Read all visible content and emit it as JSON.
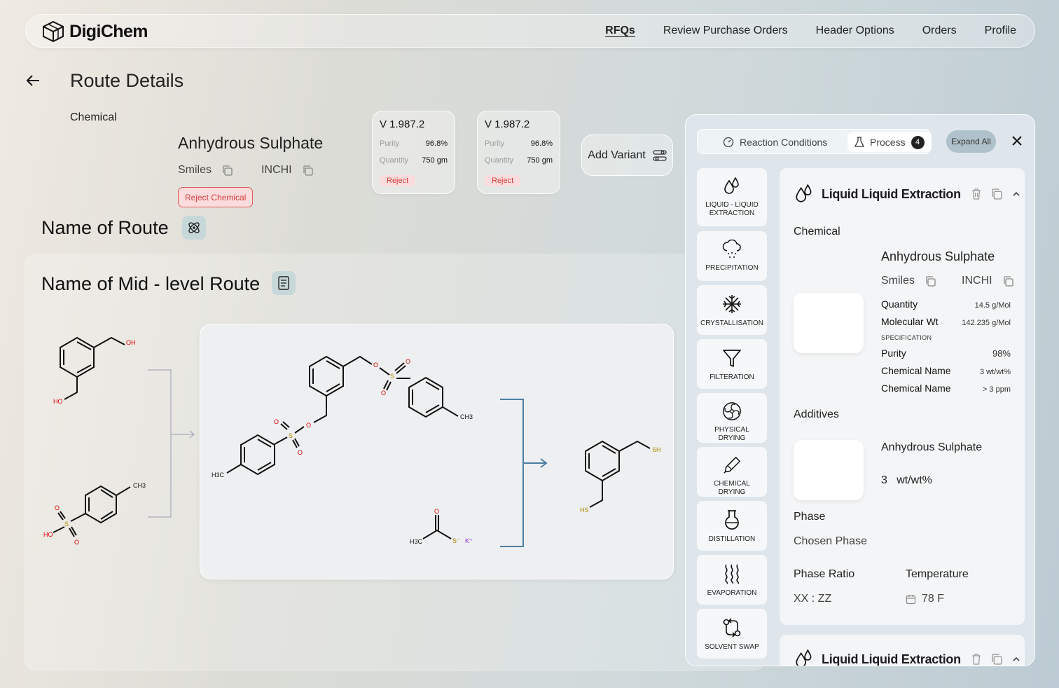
{
  "nav": {
    "brand": "DigiChem",
    "links": [
      "RFQs",
      "Review Purchase Orders",
      "Header Options",
      "Orders",
      "Profile"
    ]
  },
  "page": {
    "title": "Route Details",
    "chemical_label": "Chemical",
    "chemical_name": "Anhydrous Sulphate",
    "smiles_label": "Smiles",
    "inchi_label": "INCHI",
    "reject_chemical": "Reject Chemical"
  },
  "variants": [
    {
      "title": "V 1.987.2",
      "purity_label": "Purity",
      "purity": "96.8%",
      "quantity_label": "Quantity",
      "quantity": "750 gm",
      "reject": "Reject"
    },
    {
      "title": "V 1.987.2",
      "purity_label": "Purity",
      "purity": "96.8%",
      "quantity_label": "Quantity",
      "quantity": "750 gm",
      "reject": "Reject"
    }
  ],
  "add_variant": "Add Variant",
  "route": {
    "name": "Name of Route",
    "mid_level_name": "Name of Mid - level Route"
  },
  "structures": {
    "reactant1": {
      "oh": "OH",
      "ho": "HO"
    },
    "reactant2": {
      "ch3": "CH3",
      "s": "S",
      "o": "O",
      "ho": "HO"
    },
    "main": {
      "ch3": "CH3",
      "h3c": "H3C",
      "o": "O",
      "s": "S"
    },
    "reagent": {
      "h3c": "H3C",
      "o": "O",
      "s": "S⁻",
      "k": "K⁺"
    },
    "product": {
      "sh": "SH",
      "hs": "HS"
    }
  },
  "panel": {
    "tabs": {
      "reaction_conditions": "Reaction Conditions",
      "process": "Process",
      "process_count": "4"
    },
    "expand_all": "Expand All",
    "processes": [
      {
        "label": "LIQUID - LIQUID EXTRACTION",
        "icon": "drops-icon"
      },
      {
        "label": "PRECIPITATION",
        "icon": "cloud-rain-icon"
      },
      {
        "label": "CRYSTALLISATION",
        "icon": "snowflake-icon"
      },
      {
        "label": "FILTERATION",
        "icon": "funnel-icon"
      },
      {
        "label": "PHYSICAL DRYING",
        "icon": "fan-icon"
      },
      {
        "label": "CHEMICAL DRYING",
        "icon": "pipette-icon"
      },
      {
        "label": "DISTILLATION",
        "icon": "flask-icon"
      },
      {
        "label": "EVAPORATION",
        "icon": "heat-waves-icon"
      },
      {
        "label": "SOLVENT SWAP",
        "icon": "swap-icon"
      }
    ],
    "detail": {
      "title": "Liquid Liquid Extraction",
      "chemical_label": "Chemical",
      "chemical_name": "Anhydrous Sulphate",
      "smiles_label": "Smiles",
      "inchi_label": "INCHI",
      "quantity_label": "Quantity",
      "quantity": "14.5  g/Mol",
      "mol_wt_label": "Molecular Wt",
      "mol_wt": "142.235  g/Mol",
      "specification": "SPECIFICATION",
      "purity_label": "Purity",
      "purity": "98%",
      "chem_name_label_1": "Chemical Name",
      "chem_name_value_1": "3 wt/wt%",
      "chem_name_label_2": "Chemical Name",
      "chem_name_value_2": "> 3 ppm",
      "additives_label": "Additives",
      "additive_name": "Anhydrous Sulphate",
      "additive_amount": "3   wt/wt%",
      "phase_label": "Phase",
      "phase_value": "Chosen Phase",
      "phase_ratio_label": "Phase Ratio",
      "phase_ratio_value": "XX : ZZ",
      "temperature_label": "Temperature",
      "temperature_value": "78 F"
    },
    "detail2_title": "Liquid Liquid Extraction"
  }
}
